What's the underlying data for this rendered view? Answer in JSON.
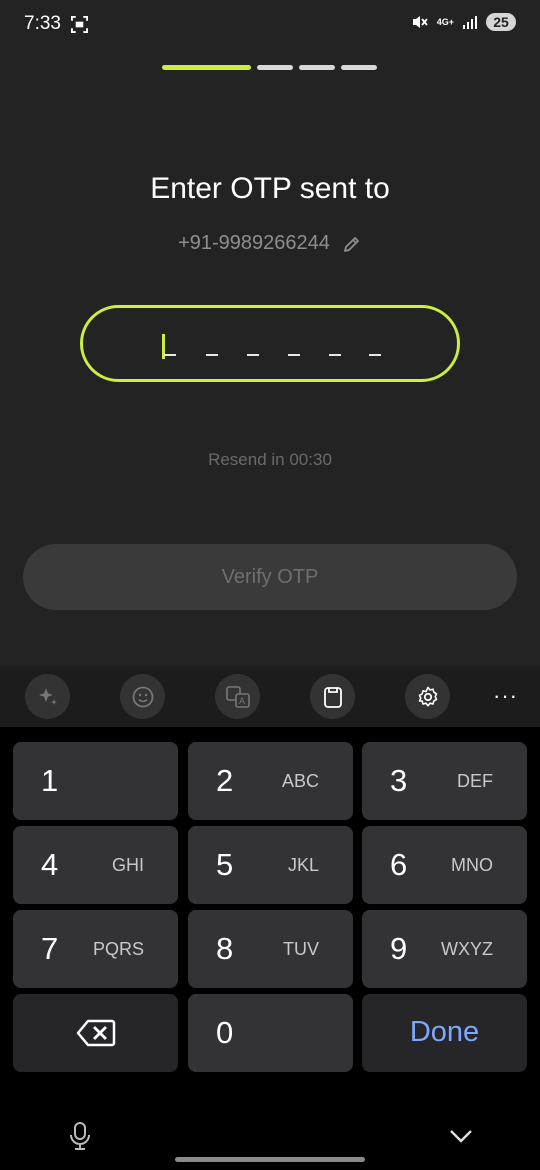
{
  "status": {
    "time": "7:33",
    "network": "4G+",
    "battery": "25"
  },
  "progress": {
    "current_step": 1,
    "total_steps": 4
  },
  "header": {
    "title": "Enter OTP sent to",
    "phone": "+91-9989266244"
  },
  "otp": {
    "placeholder": "_ _ _ _ _ _"
  },
  "resend_text": "Resend in 00:30",
  "verify_label": "Verify OTP",
  "keyboard": {
    "keys": [
      {
        "num": "1",
        "letters": ""
      },
      {
        "num": "2",
        "letters": "ABC"
      },
      {
        "num": "3",
        "letters": "DEF"
      },
      {
        "num": "4",
        "letters": "GHI"
      },
      {
        "num": "5",
        "letters": "JKL"
      },
      {
        "num": "6",
        "letters": "MNO"
      },
      {
        "num": "7",
        "letters": "PQRS"
      },
      {
        "num": "8",
        "letters": "TUV"
      },
      {
        "num": "9",
        "letters": "WXYZ"
      },
      {
        "num": "0",
        "letters": ""
      }
    ],
    "done_label": "Done",
    "more_label": "···"
  },
  "colors": {
    "accent": "#c9ef3f",
    "background": "#232323",
    "done_text": "#7ea8ff"
  },
  "icons": {
    "status": [
      "screenshot-icon",
      "mute-icon",
      "signal-icon"
    ],
    "edit": "pencil-icon",
    "toolbar": [
      "sparkle-icon",
      "emoji-icon",
      "translate-icon",
      "clipboard-icon",
      "gear-icon",
      "more-icon"
    ],
    "backspace": "backspace-icon",
    "bottom": [
      "mic-icon",
      "chevron-down-icon"
    ]
  }
}
